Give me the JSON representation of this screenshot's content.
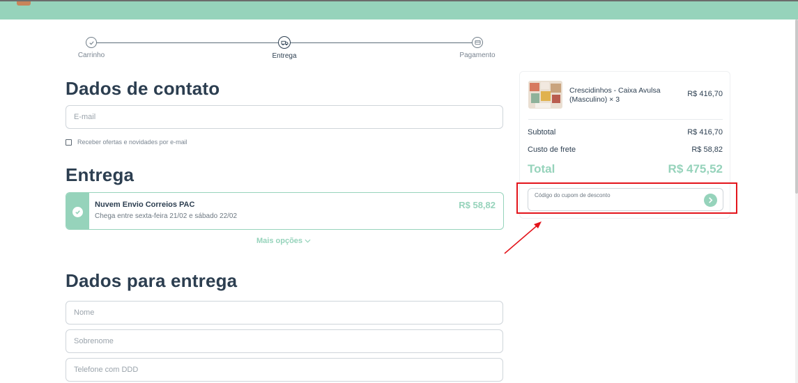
{
  "colors": {
    "accent": "#96d3bb",
    "text": "#2c3e50",
    "annotation": "#e3141b"
  },
  "stepper": {
    "steps": [
      {
        "label": "Carrinho",
        "icon": "check-icon"
      },
      {
        "label": "Entrega",
        "icon": "truck-icon"
      },
      {
        "label": "Pagamento",
        "icon": "card-icon"
      }
    ],
    "active_step": "Entrega"
  },
  "contact": {
    "title": "Dados de contato",
    "email_placeholder": "E-mail",
    "newsletter_label": "Receber ofertas e novidades por e-mail"
  },
  "shipping": {
    "title": "Entrega",
    "option": {
      "name": "Nuvem Envio Correios PAC",
      "eta": "Chega entre sexta-feira 21/02 e sábado 22/02",
      "price": "R$ 58,82"
    },
    "more_options_label": "Mais opções"
  },
  "delivery": {
    "title": "Dados para entrega",
    "name_placeholder": "Nome",
    "surname_placeholder": "Sobrenome",
    "phone_placeholder": "Telefone com DDD"
  },
  "summary": {
    "product": {
      "name": "Crescidinhos - Caixa Avulsa (Masculino) × 3",
      "price": "R$ 416,70"
    },
    "subtotal_label": "Subtotal",
    "subtotal_value": "R$ 416,70",
    "shipping_label": "Custo de frete",
    "shipping_value": "R$ 58,82",
    "total_label": "Total",
    "total_value": "R$ 475,52",
    "coupon_placeholder": "Código do cupom de desconto"
  }
}
